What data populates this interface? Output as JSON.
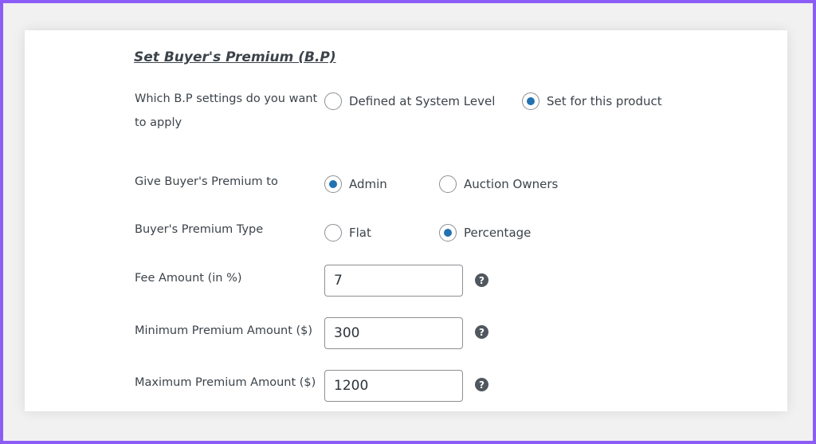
{
  "section": {
    "title": "Set Buyer's Premium (B.P)"
  },
  "settings": {
    "label_line1": "Which B.P settings do you want",
    "label_line2": "to apply",
    "options": [
      {
        "label": "Defined at System Level",
        "checked": false
      },
      {
        "label": "Set for this product",
        "checked": true
      }
    ]
  },
  "give_to": {
    "label": "Give Buyer's Premium to",
    "options": [
      {
        "label": "Admin",
        "checked": true
      },
      {
        "label": "Auction Owners",
        "checked": false
      }
    ]
  },
  "type": {
    "label": "Buyer's Premium Type",
    "options": [
      {
        "label": "Flat",
        "checked": false
      },
      {
        "label": "Percentage",
        "checked": true
      }
    ]
  },
  "fee_amount": {
    "label": "Fee Amount (in %)",
    "value": "7"
  },
  "min_amount": {
    "label": "Minimum Premium Amount ($)",
    "value": "300"
  },
  "max_amount": {
    "label": "Maximum Premium Amount ($)",
    "value": "1200"
  },
  "help_glyph": "?",
  "colors": {
    "accent": "#2271b1",
    "frame": "#8b5cf6"
  }
}
